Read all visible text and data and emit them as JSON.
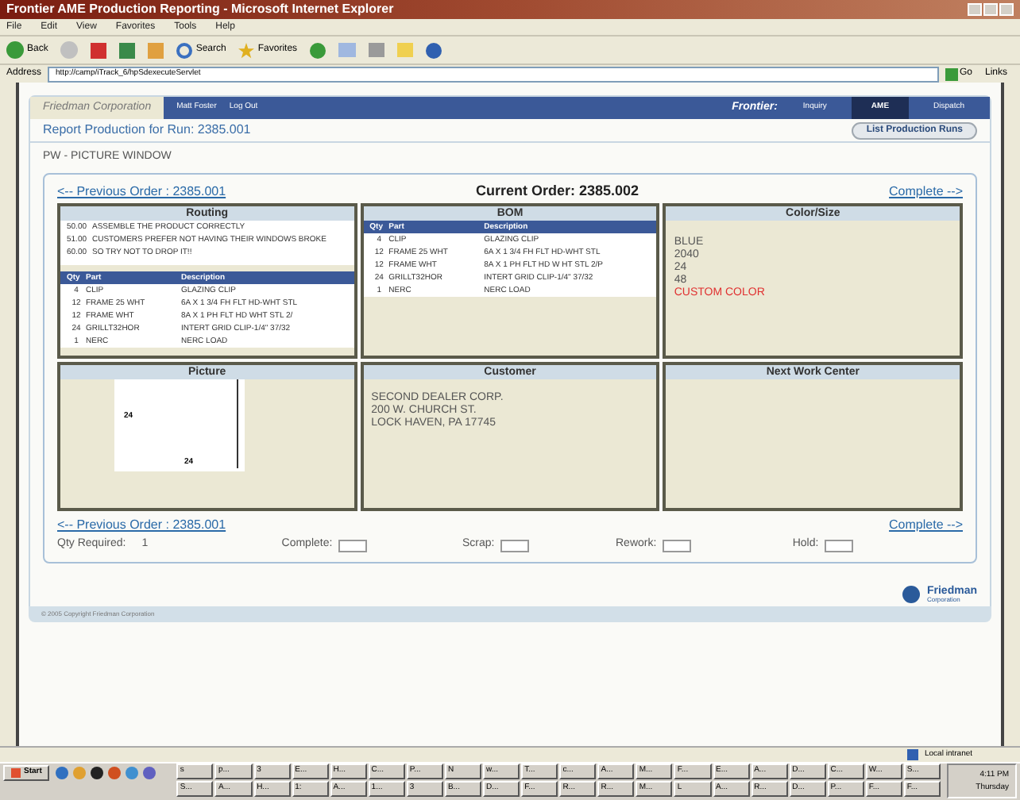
{
  "window": {
    "title": "Frontier AME Production Reporting - Microsoft Internet Explorer"
  },
  "menu": [
    "File",
    "Edit",
    "View",
    "Favorites",
    "Tools",
    "Help"
  ],
  "toolbar": {
    "back": "Back",
    "search": "Search",
    "favorites": "Favorites"
  },
  "address": {
    "label": "Address",
    "value": "http://camp/iTrack_6/hpSdexecuteServlet",
    "go": "Go",
    "links": "Links"
  },
  "app_header": {
    "company": "Friedman Corporation",
    "user": "Matt Foster",
    "logout": "Log Out",
    "brand": "Frontier:",
    "tabs": [
      {
        "label": "Inquiry",
        "selected": false
      },
      {
        "label": "AME",
        "selected": true
      },
      {
        "label": "Dispatch",
        "selected": false
      }
    ]
  },
  "page_title": "Report Production for Run: 2385.001",
  "list_button": "List Production Runs",
  "product": "PW - PICTURE WINDOW",
  "nav": {
    "previous": "<-- Previous Order : 2385.001",
    "current": "Current Order: 2385.002",
    "complete": "Complete -->"
  },
  "routing": {
    "title": "Routing",
    "steps": [
      {
        "op": "50.00",
        "text": "ASSEMBLE THE PRODUCT CORRECTLY"
      },
      {
        "op": "51.00",
        "text": "CUSTOMERS PREFER NOT HAVING THEIR WINDOWS BROKE"
      },
      {
        "op": "60.00",
        "text": "SO TRY NOT TO DROP IT!!"
      }
    ],
    "columns": [
      "Qty",
      "Part",
      "Description"
    ],
    "rows": [
      [
        "4",
        "CLIP",
        "GLAZING CLIP"
      ],
      [
        "12",
        "FRAME 25 WHT",
        "6A X 1 3/4 FH FLT HD-WHT STL"
      ],
      [
        "12",
        "FRAME WHT",
        "8A X 1 PH FLT HD WHT STL 2/"
      ],
      [
        "24",
        "GRILLT32HOR",
        "INTERT GRID CLIP-1/4\" 37/32"
      ],
      [
        "1",
        "NERC",
        "NERC LOAD"
      ]
    ]
  },
  "bom": {
    "title": "BOM",
    "columns": [
      "Qty",
      "Part",
      "Description"
    ],
    "rows": [
      [
        "4",
        "CLIP",
        "GLAZING CLIP"
      ],
      [
        "12",
        "FRAME 25 WHT",
        "6A X 1 3/4 FH FLT HD-WHT STL"
      ],
      [
        "12",
        "FRAME WHT",
        "8A X 1 PH FLT HD W HT STL 2/P"
      ],
      [
        "24",
        "GRILLT32HOR",
        "INTERT GRID CLIP-1/4\" 37/32"
      ],
      [
        "1",
        "NERC",
        "NERC LOAD"
      ]
    ]
  },
  "color_size": {
    "title": "Color/Size",
    "lines": [
      {
        "text": "BLUE",
        "kind": "normal"
      },
      {
        "text": "2040",
        "kind": "normal"
      },
      {
        "text": "24",
        "kind": "normal"
      },
      {
        "text": "48",
        "kind": "normal"
      },
      {
        "text": "CUSTOM COLOR",
        "kind": "alert"
      }
    ]
  },
  "picture": {
    "title": "Picture",
    "height_label": "24",
    "width_label": "24"
  },
  "customer": {
    "title": "Customer",
    "lines": [
      "SECOND DEALER CORP.",
      "200 W. CHURCH ST.",
      "LOCK HAVEN, PA 17745"
    ]
  },
  "next_work_center": {
    "title": "Next Work Center"
  },
  "bottom_nav": {
    "previous": "<-- Previous Order : 2385.001",
    "complete": "Complete -->"
  },
  "quantities": {
    "qty_label": "Qty Required:",
    "qty_value": "1",
    "fields": [
      "Complete:",
      "Scrap:",
      "Rework:",
      "Hold:"
    ]
  },
  "footer": {
    "copyright": "© 2005 Copyright Friedman Corporation",
    "logo_name": "Friedman",
    "logo_sub": "Corporation"
  },
  "status_bar": {
    "zone": "Local intranet"
  },
  "taskbar": {
    "start": "Start",
    "row1": [
      "s",
      "p...",
      "3",
      "E...",
      "H...",
      "C...",
      "P...",
      "N",
      "w...",
      "T...",
      "c...",
      "A...",
      "M...",
      "F...",
      "E...",
      "A...",
      "D...",
      "C...",
      "W...",
      "S..."
    ],
    "row2": [
      "S...",
      "A...",
      "H...",
      "1:",
      "A...",
      "1...",
      "3",
      "B...",
      "D...",
      "F...",
      "R...",
      "R...",
      "M...",
      "L",
      "A...",
      "R...",
      "D...",
      "P...",
      "F...",
      "F..."
    ],
    "time": "4:11 PM",
    "day": "Thursday"
  }
}
